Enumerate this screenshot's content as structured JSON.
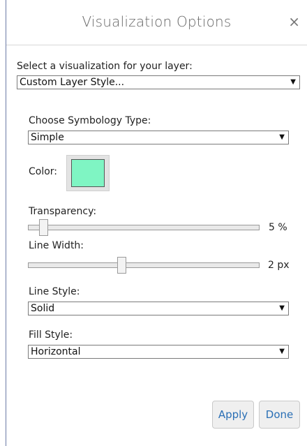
{
  "dialog": {
    "title": "Visualization Options",
    "close_glyph": "×"
  },
  "layer_select": {
    "label": "Select a visualization for your layer:",
    "value": "Custom Layer Style..."
  },
  "symbology": {
    "label": "Choose Symbology Type:",
    "value": "Simple"
  },
  "color": {
    "label": "Color:",
    "value": "#7ff5c3"
  },
  "transparency": {
    "label": "Transparency:",
    "value_text": "5 %",
    "percent": 5
  },
  "line_width": {
    "label": "Line Width:",
    "value_text": "2 px",
    "fraction": 0.4
  },
  "line_style": {
    "label": "Line Style:",
    "value": "Solid"
  },
  "fill_style": {
    "label": "Fill Style:",
    "value": "Horizontal"
  },
  "buttons": {
    "apply": "Apply",
    "done": "Done"
  },
  "icons": {
    "dropdown": "chevron-down-icon",
    "close": "close-icon"
  }
}
